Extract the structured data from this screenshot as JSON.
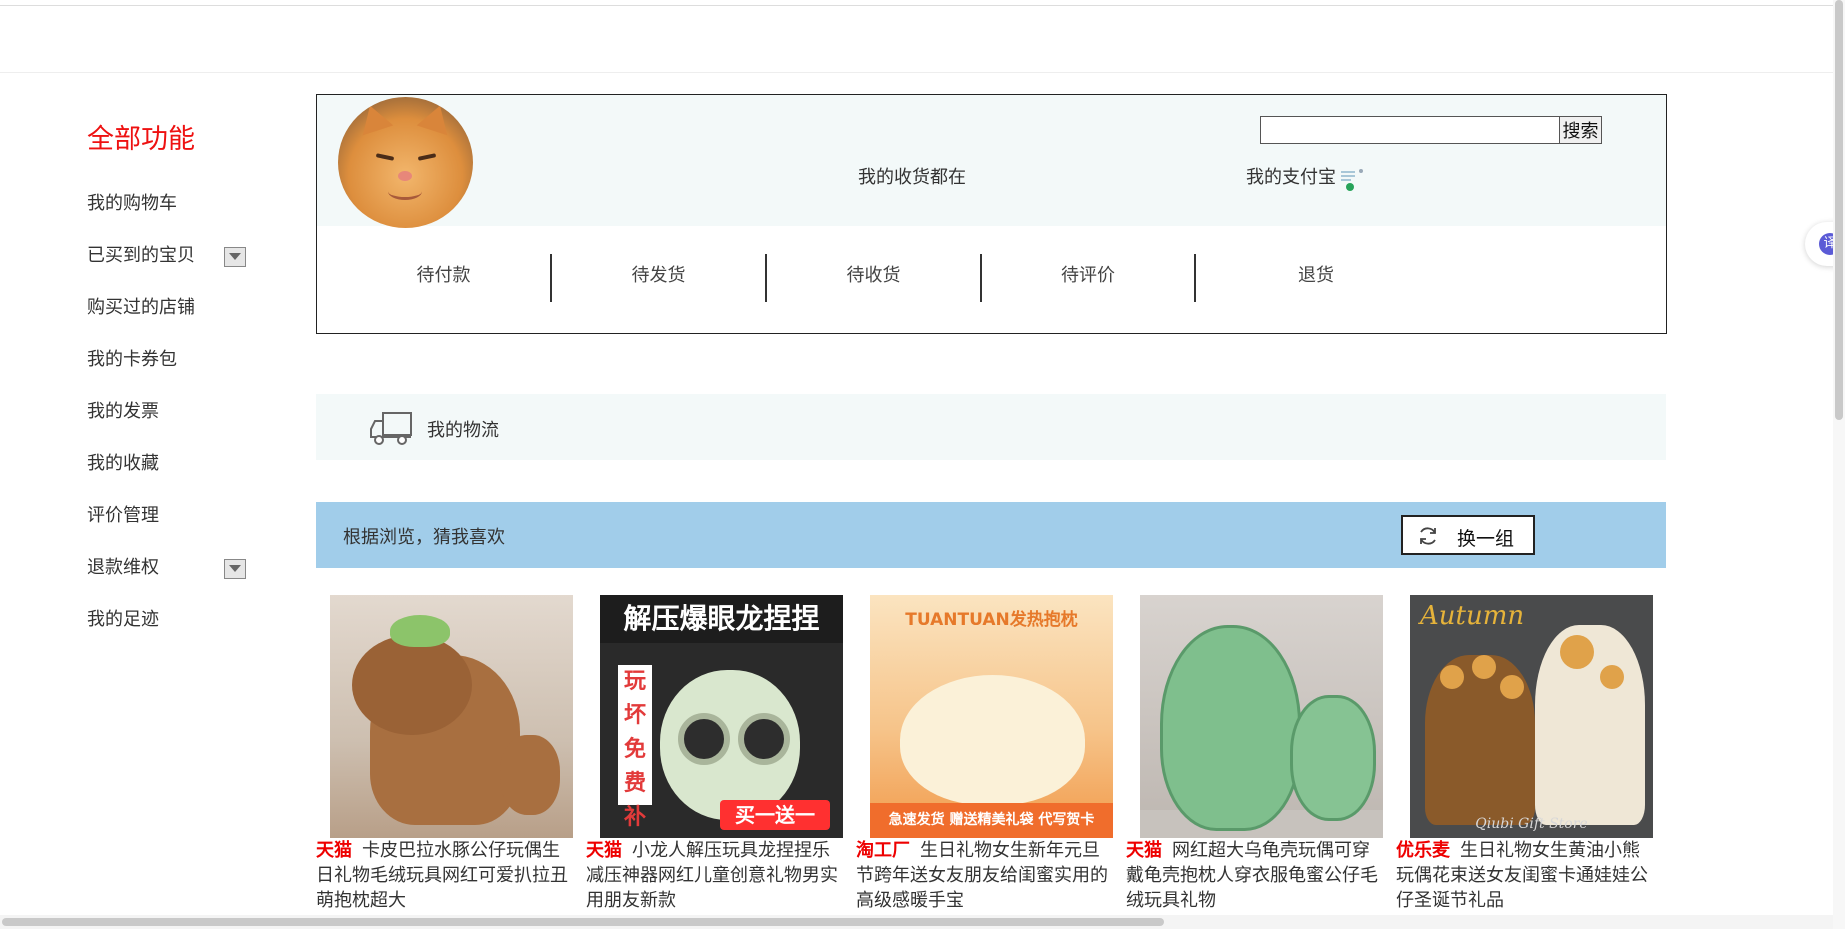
{
  "sidebar": {
    "title": "全部功能",
    "items": [
      {
        "label": "我的购物车"
      },
      {
        "label": "已买到的宝贝"
      },
      {
        "label": "购买过的店铺"
      },
      {
        "label": "我的卡券包"
      },
      {
        "label": "我的发票"
      },
      {
        "label": "我的收藏"
      },
      {
        "label": "评价管理"
      },
      {
        "label": "退款维权"
      },
      {
        "label": "我的足迹"
      }
    ]
  },
  "profile": {
    "address_label": "我的收货都在",
    "alipay_label": "我的支付宝",
    "search": {
      "value": "",
      "button": "搜索"
    },
    "orders": [
      "待付款",
      "待发货",
      "待收货",
      "待评价",
      "退货"
    ]
  },
  "logistics": {
    "label": "我的物流"
  },
  "recommend": {
    "label": "根据浏览，猜我喜欢",
    "refresh_label": "换一组"
  },
  "products": [
    {
      "shop": "天猫",
      "title": "卡皮巴拉水豚公仔玩偶生日礼物毛绒玩具网红可爱扒拉丑萌抱枕超大"
    },
    {
      "shop": "天猫",
      "title": "小龙人解压玩具龙捏捏乐减压神器网红儿童创意礼物男实用朋友新款",
      "image_text": {
        "banner": "解压爆眼龙捏捏",
        "side": "玩坏免费补发",
        "tag": "买一送一"
      }
    },
    {
      "shop": "淘工厂",
      "title": "生日礼物女生新年元旦节跨年送女友朋友给闺蜜实用的高级感暖手宝",
      "image_text": {
        "brand": "TUANTUAN发热抱枕",
        "strip": "急速发货 赠送精美礼袋 代写贺卡"
      }
    },
    {
      "shop": "天猫",
      "title": "网红超大乌龟壳玩偶可穿戴龟壳抱枕人穿衣服龟蜜公仔毛绒玩具礼物"
    },
    {
      "shop": "优乐麦",
      "title": "生日礼物女生黄油小熊玩偶花束送女友闺蜜卡通娃娃公仔圣诞节礼品",
      "image_text": {
        "autumn": "Autumn",
        "store": "Qiubi Gift Store"
      }
    }
  ],
  "translate": {
    "label": "译"
  },
  "colors": {
    "accent_red": "#ee1111",
    "recommend_bar": "#a1cdea",
    "profile_bg": "#f3f9f9"
  },
  "icons": [
    "chevron-down-icon",
    "truck-icon",
    "refresh-icon",
    "alipay-icon",
    "translate-icon"
  ]
}
